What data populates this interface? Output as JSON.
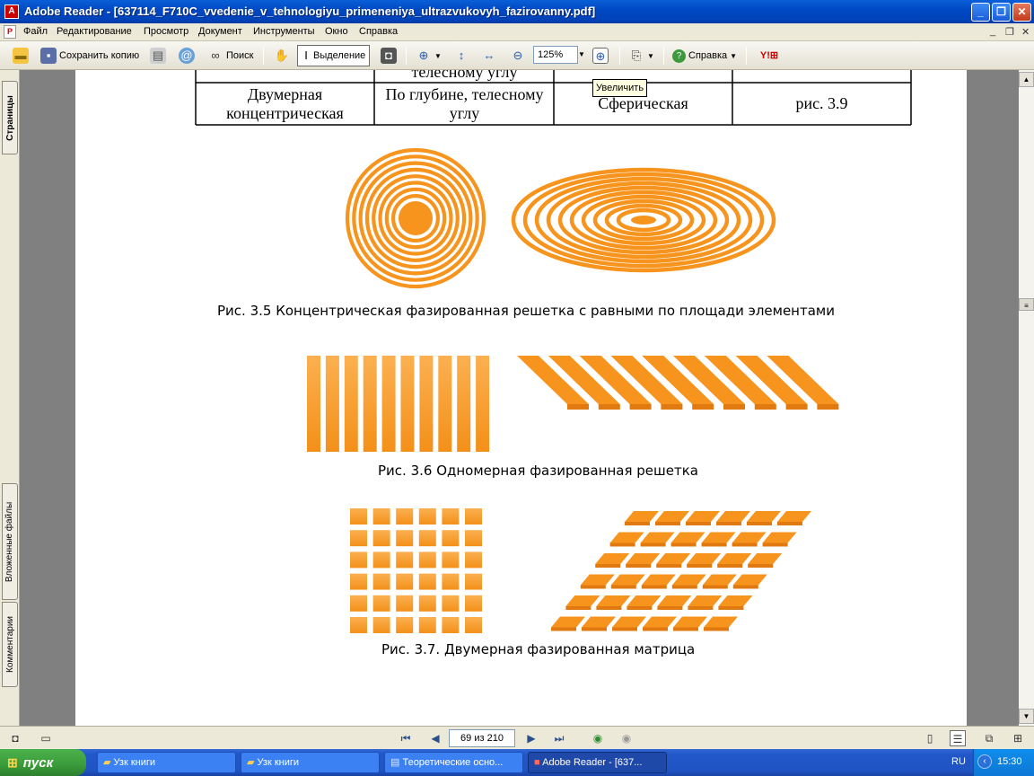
{
  "window": {
    "title": "Adobe Reader - [637114_F710C_vvedenie_v_tehnologiyu_primeneniya_ultrazvukovyh_fazirovanny.pdf]",
    "minimize": "_",
    "maximize": "❐",
    "close": "✕"
  },
  "menu": {
    "items": [
      "Файл",
      "Редактирование",
      "Просмотр",
      "Документ",
      "Инструменты",
      "Окно",
      "Справка"
    ],
    "doc_controls": [
      "_",
      "❐",
      "✕"
    ]
  },
  "toolbar": {
    "save_copy": "Сохранить копию",
    "search": "Поиск",
    "select": "Выделение",
    "zoom": "125%",
    "help": "Справка"
  },
  "tooltip": "Увеличить",
  "side_tabs": {
    "pages": "Страницы",
    "attachments": "Вложенные файлы",
    "comments": "Комментарии"
  },
  "document": {
    "table_partial_top": "телесному углу",
    "table_row": [
      "Двумерная концентрическая",
      "По глубине, телесному углу",
      "Сферическая",
      "рис. 3.9"
    ],
    "figure_3_5_caption": "Рис. 3.5 Концентрическая фазированная решетка с равными по площади элементами",
    "figure_3_6_caption": "Рис. 3.6 Одномерная фазированная решетка",
    "figure_3_7_caption": "Рис. 3.7. Двумерная фазированная матрица",
    "accent_color": "#f7941d"
  },
  "status": {
    "page_indicator": "69 из 210"
  },
  "taskbar": {
    "start": "пуск",
    "tasks": [
      "Узк книги",
      "Узк книги",
      "Теоретические осно...",
      "Adobe Reader - [637..."
    ],
    "lang": "RU",
    "clock": "15:30"
  }
}
